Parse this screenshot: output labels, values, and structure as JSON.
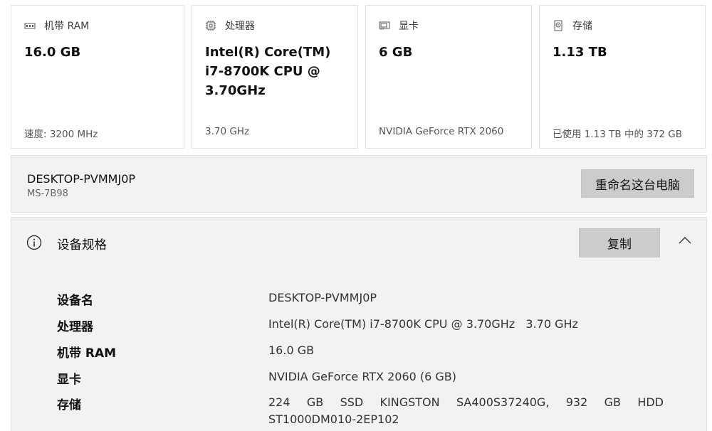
{
  "cards": [
    {
      "icon": "ram-icon",
      "title": "机带 RAM",
      "value": "16.0 GB",
      "sub": "速度: 3200 MHz"
    },
    {
      "icon": "processor-icon",
      "title": "处理器",
      "value": "Intel(R) Core(TM) i7-8700K CPU @ 3.70GHz",
      "sub": "3.70 GHz"
    },
    {
      "icon": "graphics-card-icon",
      "title": "显卡",
      "value": "6 GB",
      "sub": "NVIDIA GeForce RTX 2060"
    },
    {
      "icon": "storage-icon",
      "title": "存储",
      "value": "1.13 TB",
      "sub": "已使用 1.13 TB 中的 372 GB"
    }
  ],
  "device": {
    "name": "DESKTOP-PVMMJ0P",
    "model": "MS-7B98",
    "rename_label": "重命名这台电脑"
  },
  "specs": {
    "title": "设备规格",
    "copy_label": "复制",
    "rows": [
      {
        "label": "设备名",
        "value": "DESKTOP-PVMMJ0P"
      },
      {
        "label": "处理器",
        "value": "Intel(R) Core(TM) i7-8700K CPU @ 3.70GHz   3.70 GHz"
      },
      {
        "label": "机带 RAM",
        "value": "16.0 GB"
      },
      {
        "label": "显卡",
        "value": "NVIDIA GeForce RTX 2060 (6 GB)"
      },
      {
        "label": "存储",
        "value": "224 GB SSD KINGSTON SA400S37240G, 932 GB HDD ST1000DM010-2EP102"
      }
    ]
  },
  "colors": {
    "card_border": "#e3e3e3",
    "panel_bg": "#f2f2f2",
    "button_bg": "#cccccc"
  }
}
